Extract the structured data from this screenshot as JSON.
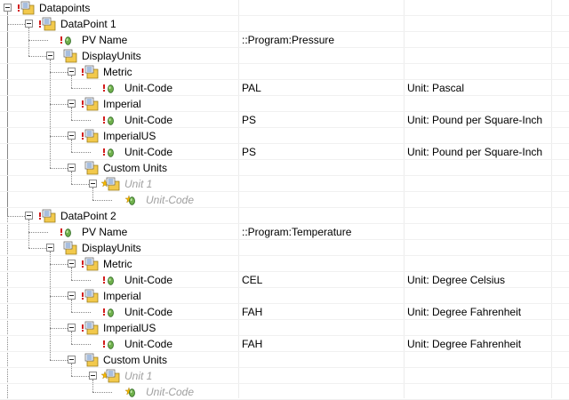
{
  "tree": {
    "root": {
      "label": "Datapoints",
      "icon": "folder-list-icon"
    },
    "datapoints": [
      {
        "label": "DataPoint 1",
        "pv_name": {
          "label": "PV Name",
          "value": "::Program:Pressure"
        },
        "display_units": {
          "label": "DisplayUnits",
          "systems": [
            {
              "label": "Metric",
              "unit_code_label": "Unit-Code",
              "code": "PAL",
              "description": "Unit: Pascal"
            },
            {
              "label": "Imperial",
              "unit_code_label": "Unit-Code",
              "code": "PS",
              "description": "Unit: Pound per Square-Inch"
            },
            {
              "label": "ImperialUS",
              "unit_code_label": "Unit-Code",
              "code": "PS",
              "description": "Unit: Pound per Square-Inch"
            }
          ],
          "custom": {
            "label": "Custom Units",
            "unit_placeholder": "Unit 1",
            "unit_code_placeholder": "Unit-Code"
          }
        }
      },
      {
        "label": "DataPoint 2",
        "pv_name": {
          "label": "PV Name",
          "value": "::Program:Temperature"
        },
        "display_units": {
          "label": "DisplayUnits",
          "systems": [
            {
              "label": "Metric",
              "unit_code_label": "Unit-Code",
              "code": "CEL",
              "description": "Unit: Degree Celsius"
            },
            {
              "label": "Imperial",
              "unit_code_label": "Unit-Code",
              "code": "FAH",
              "description": "Unit: Degree Fahrenheit"
            },
            {
              "label": "ImperialUS",
              "unit_code_label": "Unit-Code",
              "code": "FAH",
              "description": "Unit: Degree Fahrenheit"
            }
          ],
          "custom": {
            "label": "Custom Units",
            "unit_placeholder": "Unit 1",
            "unit_code_placeholder": "Unit-Code"
          }
        }
      }
    ]
  },
  "colors": {
    "folder_yellow": "#f2c94c",
    "warning_red": "#d21d1d",
    "leaf_green": "#4f9a3a",
    "ghost_text": "#a0a0a0",
    "new_item_star": "#f5b800"
  }
}
